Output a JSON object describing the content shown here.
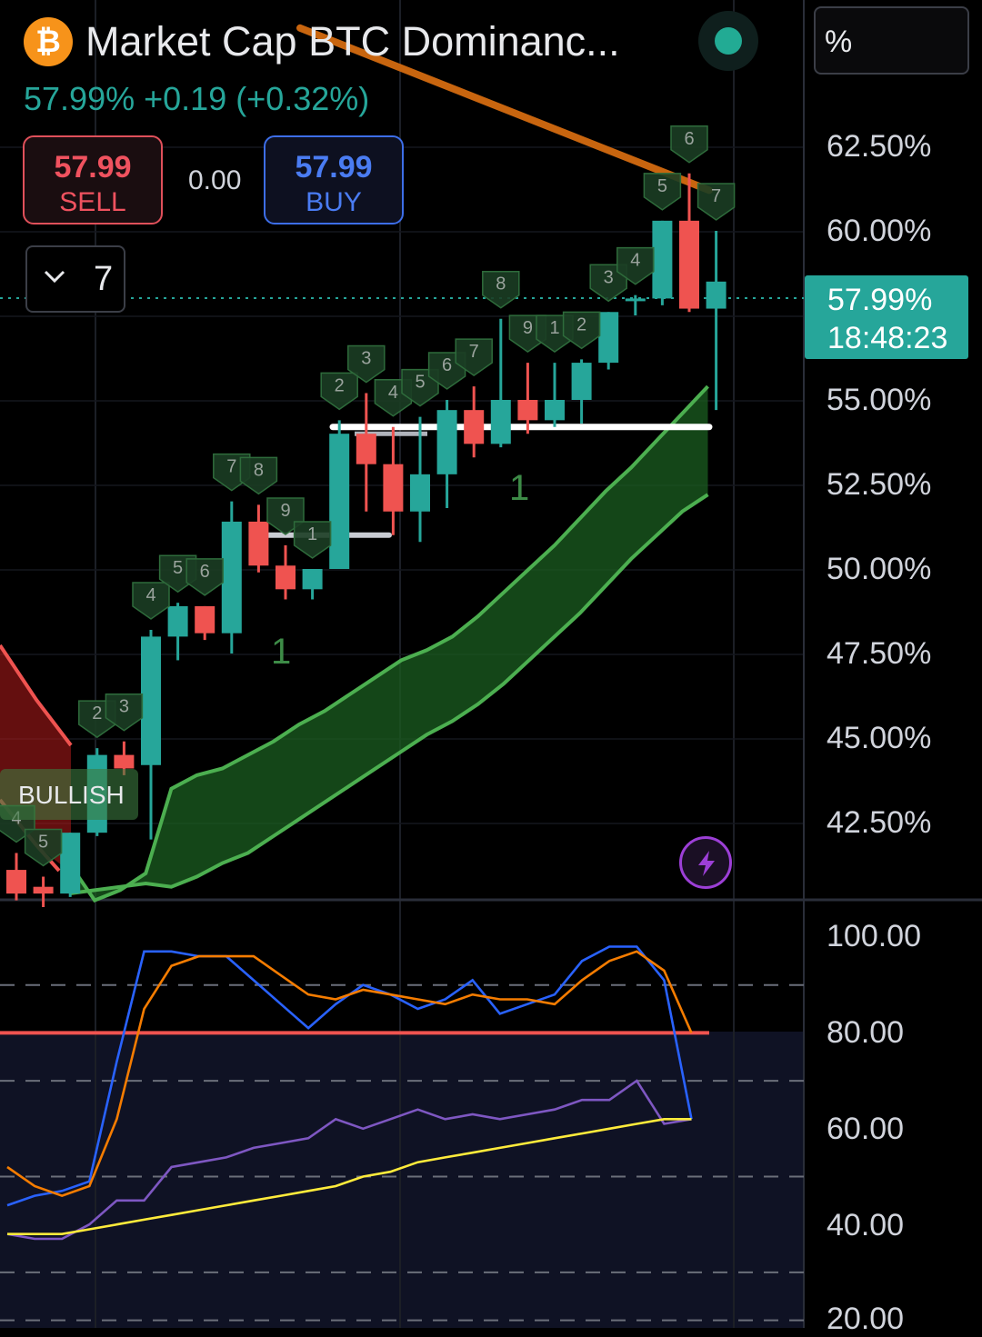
{
  "header": {
    "symbol_icon": "bitcoin-icon",
    "title": "Market Cap BTC Dominanc...",
    "price": "57.99%",
    "change": "+0.19 (+0.32%)",
    "status_color": "#22ab94"
  },
  "trade": {
    "sell_price": "57.99",
    "sell_label": "SELL",
    "spread": "0.00",
    "buy_price": "57.99",
    "buy_label": "BUY"
  },
  "interval": {
    "value": "7"
  },
  "scale_button": {
    "label": "%"
  },
  "last_price_tag": {
    "price": "57.99%",
    "countdown": "18:48:23"
  },
  "colors": {
    "up": "#26a69a",
    "down": "#ef5350",
    "accent": "#2962ff"
  },
  "chart_data": [
    {
      "type": "candlestick",
      "y_unit": "%",
      "y_ticks": [
        "62.50%",
        "60.00%",
        "55.00%",
        "52.50%",
        "50.00%",
        "47.50%",
        "45.00%",
        "42.50%"
      ],
      "candles": [
        {
          "o": 41.1,
          "h": 41.6,
          "l": 40.2,
          "c": 40.4
        },
        {
          "o": 40.6,
          "h": 40.9,
          "l": 40.0,
          "c": 40.4
        },
        {
          "o": 40.4,
          "h": 42.2,
          "l": 40.3,
          "c": 42.2
        },
        {
          "o": 42.2,
          "h": 44.7,
          "l": 42.1,
          "c": 44.5
        },
        {
          "o": 44.5,
          "h": 44.9,
          "l": 43.9,
          "c": 44.1
        },
        {
          "o": 44.2,
          "h": 48.2,
          "l": 42.0,
          "c": 48.0
        },
        {
          "o": 48.0,
          "h": 49.0,
          "l": 47.3,
          "c": 48.9
        },
        {
          "o": 48.9,
          "h": 48.9,
          "l": 47.9,
          "c": 48.1
        },
        {
          "o": 48.1,
          "h": 52.0,
          "l": 47.5,
          "c": 51.4
        },
        {
          "o": 51.4,
          "h": 51.9,
          "l": 49.9,
          "c": 50.1
        },
        {
          "o": 50.1,
          "h": 50.7,
          "l": 49.1,
          "c": 49.4
        },
        {
          "o": 49.4,
          "h": 50.0,
          "l": 49.1,
          "c": 50.0
        },
        {
          "o": 50.0,
          "h": 54.4,
          "l": 50.0,
          "c": 54.0
        },
        {
          "o": 54.0,
          "h": 55.2,
          "l": 51.7,
          "c": 53.1
        },
        {
          "o": 53.1,
          "h": 54.2,
          "l": 51.0,
          "c": 51.7
        },
        {
          "o": 51.7,
          "h": 54.5,
          "l": 50.8,
          "c": 52.8
        },
        {
          "o": 52.8,
          "h": 55.0,
          "l": 51.8,
          "c": 54.7
        },
        {
          "o": 54.7,
          "h": 55.4,
          "l": 53.3,
          "c": 53.7
        },
        {
          "o": 53.7,
          "h": 57.4,
          "l": 53.6,
          "c": 55.0
        },
        {
          "o": 55.0,
          "h": 56.1,
          "l": 54.0,
          "c": 54.4
        },
        {
          "o": 54.4,
          "h": 56.1,
          "l": 54.2,
          "c": 55.0
        },
        {
          "o": 55.0,
          "h": 56.2,
          "l": 54.3,
          "c": 56.1
        },
        {
          "o": 56.1,
          "h": 57.6,
          "l": 55.9,
          "c": 57.6
        },
        {
          "o": 58.0,
          "h": 58.1,
          "l": 57.5,
          "c": 58.0
        },
        {
          "o": 58.0,
          "h": 60.3,
          "l": 57.8,
          "c": 60.3
        },
        {
          "o": 60.3,
          "h": 61.7,
          "l": 57.6,
          "c": 57.7
        },
        {
          "o": 57.7,
          "h": 60.0,
          "l": 54.7,
          "c": 58.5
        }
      ],
      "sequential_counts": [
        "4",
        "5",
        "",
        "2",
        "3",
        "4",
        "5",
        "6",
        "7",
        "8",
        "9",
        "1",
        "2",
        "3",
        "4",
        "5",
        "6",
        "7",
        "8",
        "9",
        "1",
        "2",
        "3",
        "4",
        "5",
        "6",
        "7"
      ],
      "labels": [
        "BULLISH",
        "1",
        "1"
      ],
      "ribbon_upper": [
        41.3,
        40.2,
        40.5,
        41.0,
        43.5,
        43.9,
        44.1,
        44.5,
        44.9,
        45.4,
        45.8,
        46.3,
        46.8,
        47.3,
        47.6,
        48.0,
        48.6,
        49.3,
        50.0,
        50.7,
        51.5,
        52.3,
        53.0,
        53.8,
        54.6,
        55.4
      ],
      "ribbon_lower": [
        40.4,
        40.5,
        40.6,
        40.7,
        40.6,
        40.9,
        41.3,
        41.6,
        42.1,
        42.6,
        43.1,
        43.6,
        44.1,
        44.6,
        45.1,
        45.5,
        46.0,
        46.6,
        47.3,
        48.0,
        48.7,
        49.5,
        50.3,
        51.0,
        51.7,
        52.2
      ],
      "resistance_line": {
        "from": 66.0,
        "to": 61.2
      }
    },
    {
      "type": "line",
      "y_ticks": [
        "100.00",
        "80.00",
        "60.00",
        "40.00",
        "20.00"
      ],
      "ylim": [
        20,
        100
      ],
      "levels": [
        80,
        70,
        50,
        30
      ],
      "series": [
        {
          "color": "#2962ff",
          "values": [
            44,
            46,
            47,
            49,
            74,
            97,
            97,
            96,
            96,
            91,
            86,
            81,
            86,
            90,
            88,
            85,
            87,
            91,
            84,
            86,
            88,
            95,
            98,
            98,
            91,
            62
          ]
        },
        {
          "color": "#f57c00",
          "values": [
            52,
            48,
            46,
            48,
            62,
            85,
            94,
            96,
            96,
            96,
            92,
            88,
            87,
            89,
            88,
            87,
            86,
            88,
            87,
            87,
            86,
            91,
            95,
            97,
            93,
            80
          ]
        },
        {
          "color": "#7e57c2",
          "values": [
            38,
            37,
            37,
            40,
            45,
            45,
            52,
            53,
            54,
            56,
            57,
            58,
            62,
            60,
            62,
            64,
            62,
            63,
            62,
            63,
            64,
            66,
            66,
            70,
            61,
            62
          ]
        },
        {
          "color": "#ffeb3b",
          "values": [
            38,
            38,
            38,
            39,
            40,
            41,
            42,
            43,
            44,
            45,
            46,
            47,
            48,
            50,
            51,
            53,
            54,
            55,
            56,
            57,
            58,
            59,
            60,
            61,
            62,
            62
          ]
        }
      ]
    }
  ]
}
